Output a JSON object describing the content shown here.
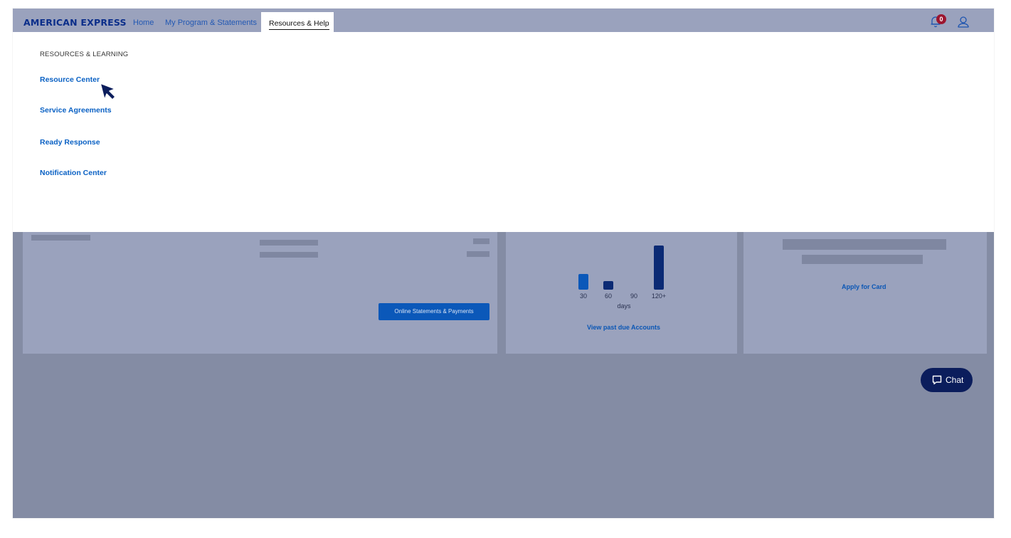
{
  "nav": {
    "logo": "AMERICAN EXPRESS",
    "links": [
      "Home",
      "My Program & Statements"
    ],
    "active_tab": "Resources & Help",
    "notification_count": "0"
  },
  "dropdown": {
    "heading": "RESOURCES & LEARNING",
    "links": [
      "Resource Center",
      "Service Agreements",
      "Ready Response",
      "Notification Center"
    ]
  },
  "cards": {
    "statements_button": "Online Statements & Payments",
    "past_due": {
      "ticks": [
        "30",
        "60",
        "90",
        "120+"
      ],
      "unit": "days",
      "link": "View past due Accounts"
    },
    "apply_link": "Apply for Card"
  },
  "chat": {
    "label": "Chat"
  },
  "colors": {
    "accent_blue": "#0a61c4",
    "dark_navy": "#0b1d5c",
    "badge_red": "#9c1630"
  }
}
